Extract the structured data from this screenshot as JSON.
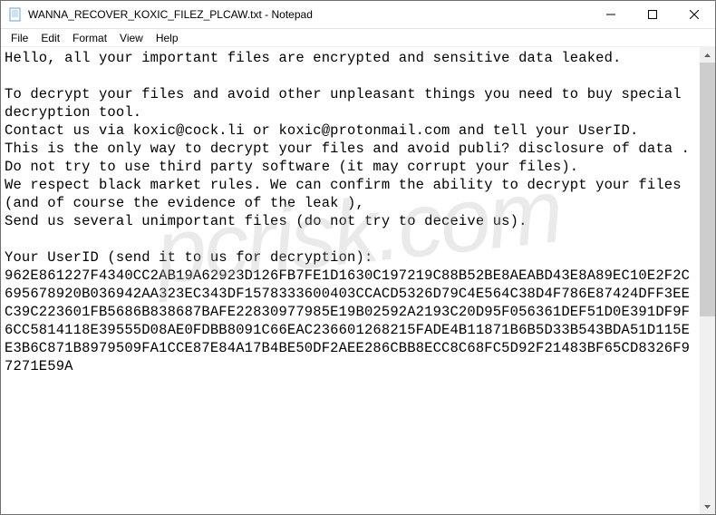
{
  "window": {
    "title": "WANNA_RECOVER_KOXIC_FILEZ_PLCAW.txt - Notepad"
  },
  "menu": {
    "file": "File",
    "edit": "Edit",
    "format": "Format",
    "view": "View",
    "help": "Help"
  },
  "content": {
    "text": "Hello, all your important files are encrypted and sensitive data leaked.\n\nTo decrypt your files and avoid other unpleasant things you need to buy special decryption tool.\nContact us via koxic@cock.li or koxic@protonmail.com and tell your UserID.\nThis is the only way to decrypt your files and avoid publi? disclosure of data .\nDo not try to use third party software (it may corrupt your files).\nWe respect black market rules. We can confirm the ability to decrypt your files (and of course the evidence of the leak ),\nSend us several unimportant files (do not try to deceive us).\n\nYour UserID (send it to us for decryption):\n962E861227F4340CC2AB19A62923D126FB7FE1D1630C197219C88B52BE8AEABD43E8A89EC10E2F2C695678920B036942AA323EC343DF1578333600403CCACD5326D79C4E564C38D4F786E87424DFF3EEC39C223601FB5686B838687BAFE22830977985E19B02592A2193C20D95F056361DEF51D0E391DF9F6CC5814118E39555D08AE0FDBB8091C66EAC236601268215FADE4B11871B6B5D33B543BDA51D115EE3B6C871B8979509FA1CCE87E84A17B4BE50DF2AEE286CBB8ECC8C68FC5D92F21483BF65CD8326F97271E59A"
  },
  "watermark": {
    "text": "pcrisk.com"
  }
}
